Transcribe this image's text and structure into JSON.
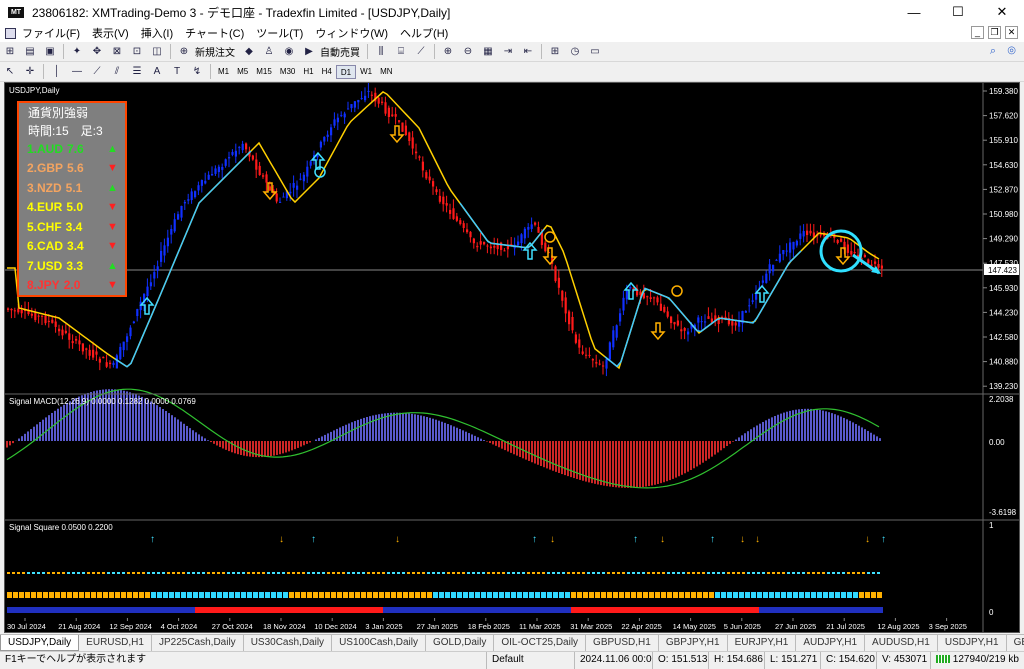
{
  "window": {
    "title": "23806182: XMTrading-Demo 3 - デモ口座 - Tradexfin Limited - [USDJPY,Daily]",
    "minimize": "—",
    "maximize": "☐",
    "close": "✕"
  },
  "menu": [
    "ファイル(F)",
    "表示(V)",
    "挿入(I)",
    "チャート(C)",
    "ツール(T)",
    "ウィンドウ(W)",
    "ヘルプ(H)"
  ],
  "toolbar1": {
    "new_order": "新規注文",
    "auto_trade": "自動売買"
  },
  "timeframes": [
    "M1",
    "M5",
    "M15",
    "M30",
    "H1",
    "H4",
    "D1",
    "W1",
    "MN"
  ],
  "active_timeframe": "D1",
  "chart": {
    "symbol_label": "USDJPY,Daily",
    "price_ticks": [
      "159.380",
      "157.620",
      "155.910",
      "154.630",
      "152.870",
      "150.980",
      "149.290",
      "147.530",
      "145.930",
      "144.230",
      "142.580",
      "140.880",
      "139.230"
    ],
    "current_price": "147.423",
    "macd_label": "Signal MACD(12,26,9) 0.0000 0.1282 0.0000 0.0769",
    "macd_ticks": [
      "2.2038",
      "0.00",
      "-3.6198"
    ],
    "square_label": "Signal Square 0.0500 0.2200",
    "square_ticks": [
      "1",
      "0"
    ],
    "date_labels": [
      "30 Jul 2024",
      "21 Aug 2024",
      "12 Sep 2024",
      "4 Oct 2024",
      "27 Oct 2024",
      "18 Nov 2024",
      "10 Dec 2024",
      "3 Jan 2025",
      "27 Jan 2025",
      "18 Feb 2025",
      "11 Mar 2025",
      "31 Mar 2025",
      "22 Apr 2025",
      "14 May 2025",
      "5 Jun 2025",
      "27 Jun 2025",
      "21 Jul 2025",
      "12 Aug 2025",
      "3 Sep 2025"
    ],
    "colors": {
      "bull": "#1030ff",
      "bear": "#ff1a1a",
      "line_up": "#40c8ff",
      "line_down": "#ffd000",
      "arrow_up": "#40e0ff",
      "arrow_down": "#ffb000",
      "macd_hist_pos": "#7070ff",
      "macd_hist_neg": "#ff3030",
      "macd_signal": "#30c030"
    }
  },
  "strength_panel": {
    "title": "通貨別強弱",
    "subtitle": "時間:15　足:3",
    "rows": [
      {
        "label": "1.AUD",
        "value": "7.6",
        "arrow": "▲",
        "color": "#22dd22",
        "arrow_color": "#22dd22"
      },
      {
        "label": "2.GBP",
        "value": "5.6",
        "arrow": "▼",
        "color": "#f4a460",
        "arrow_color": "#ff2020"
      },
      {
        "label": "3.NZD",
        "value": "5.1",
        "arrow": "▲",
        "color": "#f4a460",
        "arrow_color": "#22dd22"
      },
      {
        "label": "4.EUR",
        "value": "5.0",
        "arrow": "▼",
        "color": "#ffff00",
        "arrow_color": "#ff2020"
      },
      {
        "label": "5.CHF",
        "value": "3.4",
        "arrow": "▼",
        "color": "#ffff00",
        "arrow_color": "#ff2020"
      },
      {
        "label": "6.CAD",
        "value": "3.4",
        "arrow": "▼",
        "color": "#ffff00",
        "arrow_color": "#ff2020"
      },
      {
        "label": "7.USD",
        "value": "3.3",
        "arrow": "▲",
        "color": "#ffff00",
        "arrow_color": "#22dd22"
      },
      {
        "label": "8.JPY",
        "value": "2.0",
        "arrow": "▼",
        "color": "#ff3333",
        "arrow_color": "#ff2020"
      }
    ]
  },
  "tabs": [
    "USDJPY,Daily",
    "EURUSD,H1",
    "JP225Cash,Daily",
    "US30Cash,Daily",
    "US100Cash,Daily",
    "GOLD,Daily",
    "OIL-OCT25,Daily",
    "GBPUSD,H1",
    "GBPJPY,H1",
    "EURJPY,H1",
    "AUDJPY,H1",
    "AUDUSD,H1",
    "USDJPY,H1",
    "GBPJPY,"
  ],
  "active_tab": "USDJPY,Daily",
  "status": {
    "help": "F1キーでヘルプが表示されます",
    "profile": "Default",
    "time": "2024.11.06 00:00",
    "open": "O: 151.513",
    "high": "H: 154.686",
    "low": "L: 151.271",
    "close": "C: 154.620",
    "volume": "V: 453071",
    "traffic": "127940/219 kb"
  }
}
